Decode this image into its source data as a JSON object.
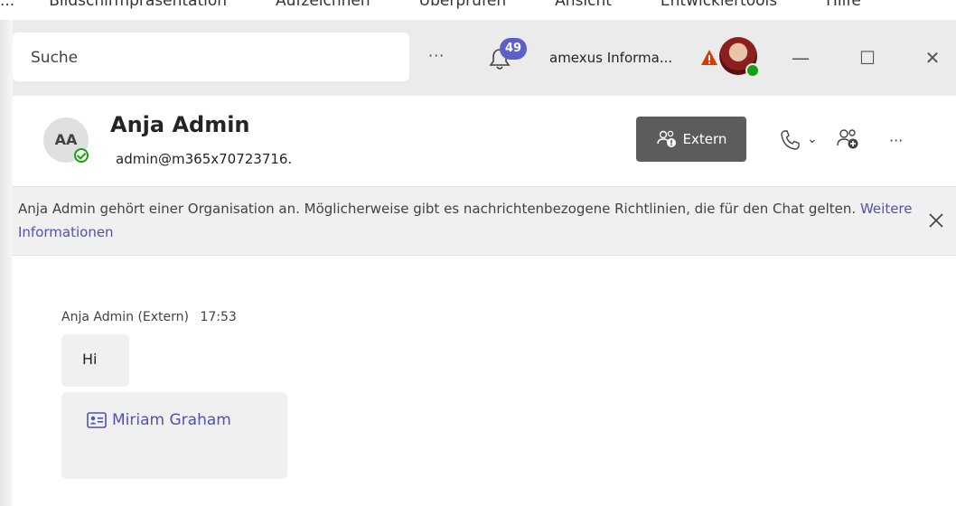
{
  "ribbon": {
    "items": [
      "...",
      "Bildschirmpräsentation",
      "Aufzeichnen",
      "Überprüfen",
      "Ansicht",
      "Entwicklertools",
      "Hilfe"
    ]
  },
  "titlebar": {
    "search_placeholder": "Suche",
    "more_label": "···",
    "notifications_count": "49",
    "org_name": "amexus Informa...",
    "minimize": "—",
    "maximize": "☐",
    "close": "✕"
  },
  "chat_header": {
    "avatar_initials": "AA",
    "name": "Anja Admin",
    "email": "admin@m365x70723716.",
    "extern_label": "Extern",
    "call_chevron": "⌄",
    "more_label": "···"
  },
  "banner": {
    "text": "Anja Admin gehört einer Organisation an. Möglicherweise gibt es nachrichtenbezogene Richtlinien, die für den Chat gelten.",
    "link": "Weitere Informationen"
  },
  "messages": {
    "sender": "Anja Admin (Extern)",
    "time": "17:53",
    "text": "Hi",
    "contact_card": "Miriam Graham"
  },
  "colors": {
    "accent": "#5b5fc7",
    "link": "#4f52b2",
    "presence": "#13a10e",
    "warning": "#d83b01",
    "extern_button": "#5c5c5c"
  }
}
